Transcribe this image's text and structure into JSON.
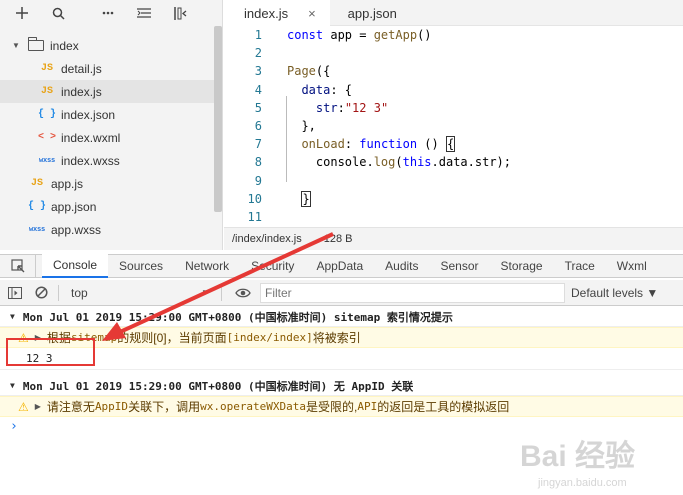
{
  "explorer": {
    "tree": [
      {
        "type": "folder",
        "name": "index",
        "indent": 0
      },
      {
        "type": "js",
        "icon": "JS",
        "name": "detail.js",
        "indent": 1
      },
      {
        "type": "js",
        "icon": "JS",
        "name": "index.js",
        "indent": 1,
        "selected": true
      },
      {
        "type": "json",
        "icon": "{ }",
        "name": "index.json",
        "indent": 1
      },
      {
        "type": "wxml",
        "icon": "< >",
        "name": "index.wxml",
        "indent": 1
      },
      {
        "type": "wxss",
        "icon": "wxss",
        "name": "index.wxss",
        "indent": 1
      },
      {
        "type": "js",
        "icon": "JS",
        "name": "app.js",
        "indent": 0
      },
      {
        "type": "json",
        "icon": "{ }",
        "name": "app.json",
        "indent": 0
      },
      {
        "type": "wxss",
        "icon": "wxss",
        "name": "app.wxss",
        "indent": 0
      }
    ]
  },
  "editor": {
    "tabs": [
      {
        "label": "index.js",
        "active": true,
        "close": "×"
      },
      {
        "label": "app.json",
        "active": false
      }
    ],
    "lines": [
      {
        "n": "1",
        "html": "<span class='kw'>const</span> app = <span class='fn'>getApp</span>()"
      },
      {
        "n": "2",
        "html": ""
      },
      {
        "n": "3",
        "html": "<span class='fn'>Page</span>({"
      },
      {
        "n": "4",
        "html": "  <span class='prop'>data</span>: {"
      },
      {
        "n": "5",
        "html": "    <span class='prop'>str</span>:<span class='str'>\"12 3\"</span>"
      },
      {
        "n": "6",
        "html": "  },"
      },
      {
        "n": "7",
        "html": "  <span class='fn'>onLoad</span>: <span class='kw'>function</span> () <span class='bracket'>{</span>"
      },
      {
        "n": "8",
        "html": "    console.<span class='fn'>log</span>(<span class='kw'>this</span>.data.str);"
      },
      {
        "n": "9",
        "html": ""
      },
      {
        "n": "10",
        "html": "  <span class='bracket'>}</span>"
      },
      {
        "n": "11",
        "html": ""
      }
    ],
    "status": {
      "path": "/index/index.js",
      "size": "128 B"
    }
  },
  "devtools": {
    "tabs": [
      "Console",
      "Sources",
      "Network",
      "Security",
      "AppData",
      "Audits",
      "Sensor",
      "Storage",
      "Trace",
      "Wxml"
    ],
    "active_tab": "Console",
    "context": "top",
    "filter_placeholder": "Filter",
    "levels": "Default levels ▼"
  },
  "console": {
    "group1": "Mon Jul 01 2019 15:29:00 GMT+0800 (中国标准时间) sitemap 索引情况提示",
    "warn1_a": "根据 ",
    "warn1_b": "sitemap",
    "warn1_c": " 的规则[0]，当前页面 ",
    "warn1_d": "[index/index]",
    "warn1_e": " 将被索引",
    "log": "12 3",
    "group2": "Mon Jul 01 2019 15:29:00 GMT+0800 (中国标准时间) 无 AppID 关联",
    "warn2_a": "请注意无 ",
    "warn2_b": "AppID",
    "warn2_c": " 关联下，调用 ",
    "warn2_d": "wx.operateWXData",
    "warn2_e": " 是受限的, ",
    "warn2_f": "API",
    "warn2_g": " 的返回是工具的模拟返回",
    "prompt": "›"
  },
  "watermark": {
    "text": "Bai 经验",
    "sub": "jingyan.baidu.com"
  },
  "colors": {
    "accent": "#1a73e8",
    "annotation": "#e53935"
  }
}
